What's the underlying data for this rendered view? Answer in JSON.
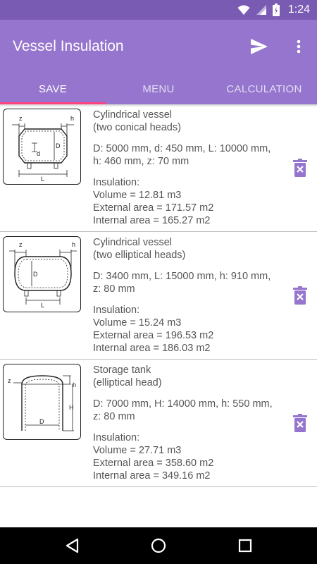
{
  "status_bar": {
    "time": "1:24"
  },
  "app_bar": {
    "title": "Vessel Insulation"
  },
  "tabs": [
    {
      "label": "SAVE",
      "active": true
    },
    {
      "label": "MENU",
      "active": false
    },
    {
      "label": "CALCULATION",
      "active": false
    }
  ],
  "items": [
    {
      "title": "Cylindrical vessel",
      "subtitle": "(two conical heads)",
      "dims_line1": "D: 5000 mm, d: 450 mm, L: 10000 mm,",
      "dims_line2": "h: 460 mm, z: 70 mm",
      "insulation_label": "Insulation:",
      "volume": "Volume = 12.81 m3",
      "external_area": "External area = 171.57 m2",
      "internal_area": "Internal area = 165.27 m2",
      "diagram_labels": {
        "z": "z",
        "h": "h",
        "d": "d",
        "D": "D",
        "L": "L"
      }
    },
    {
      "title": "Cylindrical vessel",
      "subtitle": "(two elliptical heads)",
      "dims_line1": "D: 3400 mm, L: 15000 mm, h: 910 mm,",
      "dims_line2": "z: 80 mm",
      "insulation_label": "Insulation:",
      "volume": "Volume = 15.24 m3",
      "external_area": "External area = 196.53 m2",
      "internal_area": "Internal area = 186.03 m2",
      "diagram_labels": {
        "z": "z",
        "h": "h",
        "D": "D",
        "L": "L"
      }
    },
    {
      "title": "Storage tank",
      "subtitle": "(elliptical head)",
      "dims_line1": "D: 7000 mm, H: 14000 mm, h: 550 mm,",
      "dims_line2": "z: 80 mm",
      "insulation_label": "Insulation:",
      "volume": "Volume = 27.71 m3",
      "external_area": "External area = 358.60 m2",
      "internal_area": "Internal area = 349.16 m2",
      "diagram_labels": {
        "z": "z",
        "h": "h",
        "H": "H",
        "D": "D"
      }
    }
  ],
  "colors": {
    "status_bar": "#7a5bb3",
    "app_bar": "#9575cd",
    "tab_indicator": "#ff4081",
    "delete_icon": "#9575cd"
  },
  "icons": {
    "send": "send-icon",
    "more": "more-vert-icon",
    "delete": "delete-icon",
    "back": "nav-back-icon",
    "home": "nav-home-icon",
    "recents": "nav-recents-icon"
  }
}
